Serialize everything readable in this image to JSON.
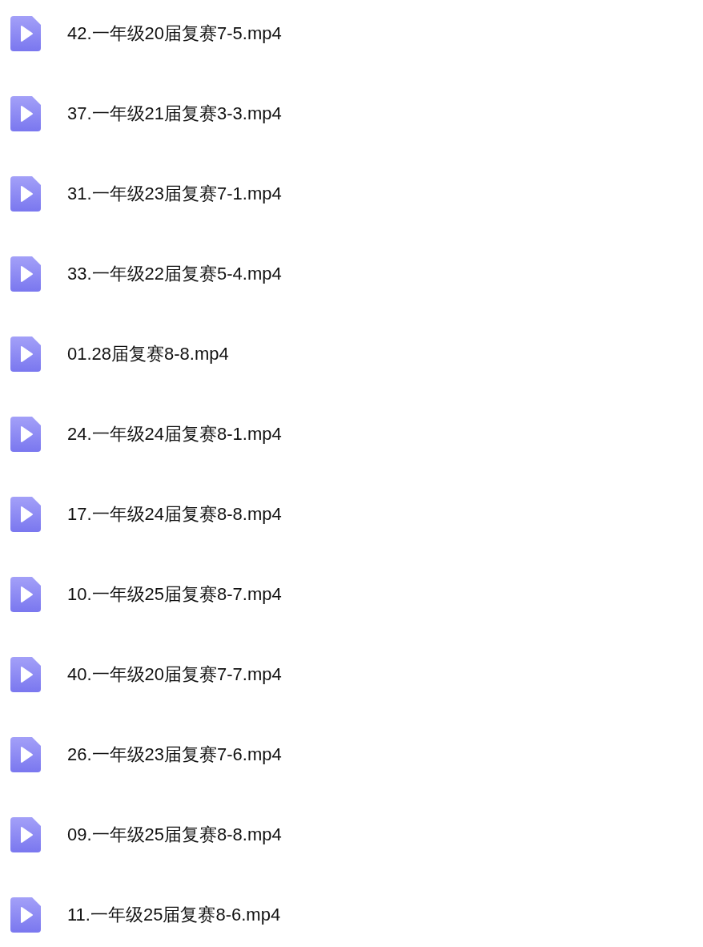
{
  "files": [
    {
      "name": "42.一年级20届复赛7-5.mp4"
    },
    {
      "name": "37.一年级21届复赛3-3.mp4"
    },
    {
      "name": "31.一年级23届复赛7-1.mp4"
    },
    {
      "name": "33.一年级22届复赛5-4.mp4"
    },
    {
      "name": "01.28届复赛8-8.mp4"
    },
    {
      "name": "24.一年级24届复赛8-1.mp4"
    },
    {
      "name": "17.一年级24届复赛8-8.mp4"
    },
    {
      "name": "10.一年级25届复赛8-7.mp4"
    },
    {
      "name": "40.一年级20届复赛7-7.mp4"
    },
    {
      "name": "26.一年级23届复赛7-6.mp4"
    },
    {
      "name": "09.一年级25届复赛8-8.mp4"
    },
    {
      "name": "11.一年级25届复赛8-6.mp4"
    }
  ]
}
